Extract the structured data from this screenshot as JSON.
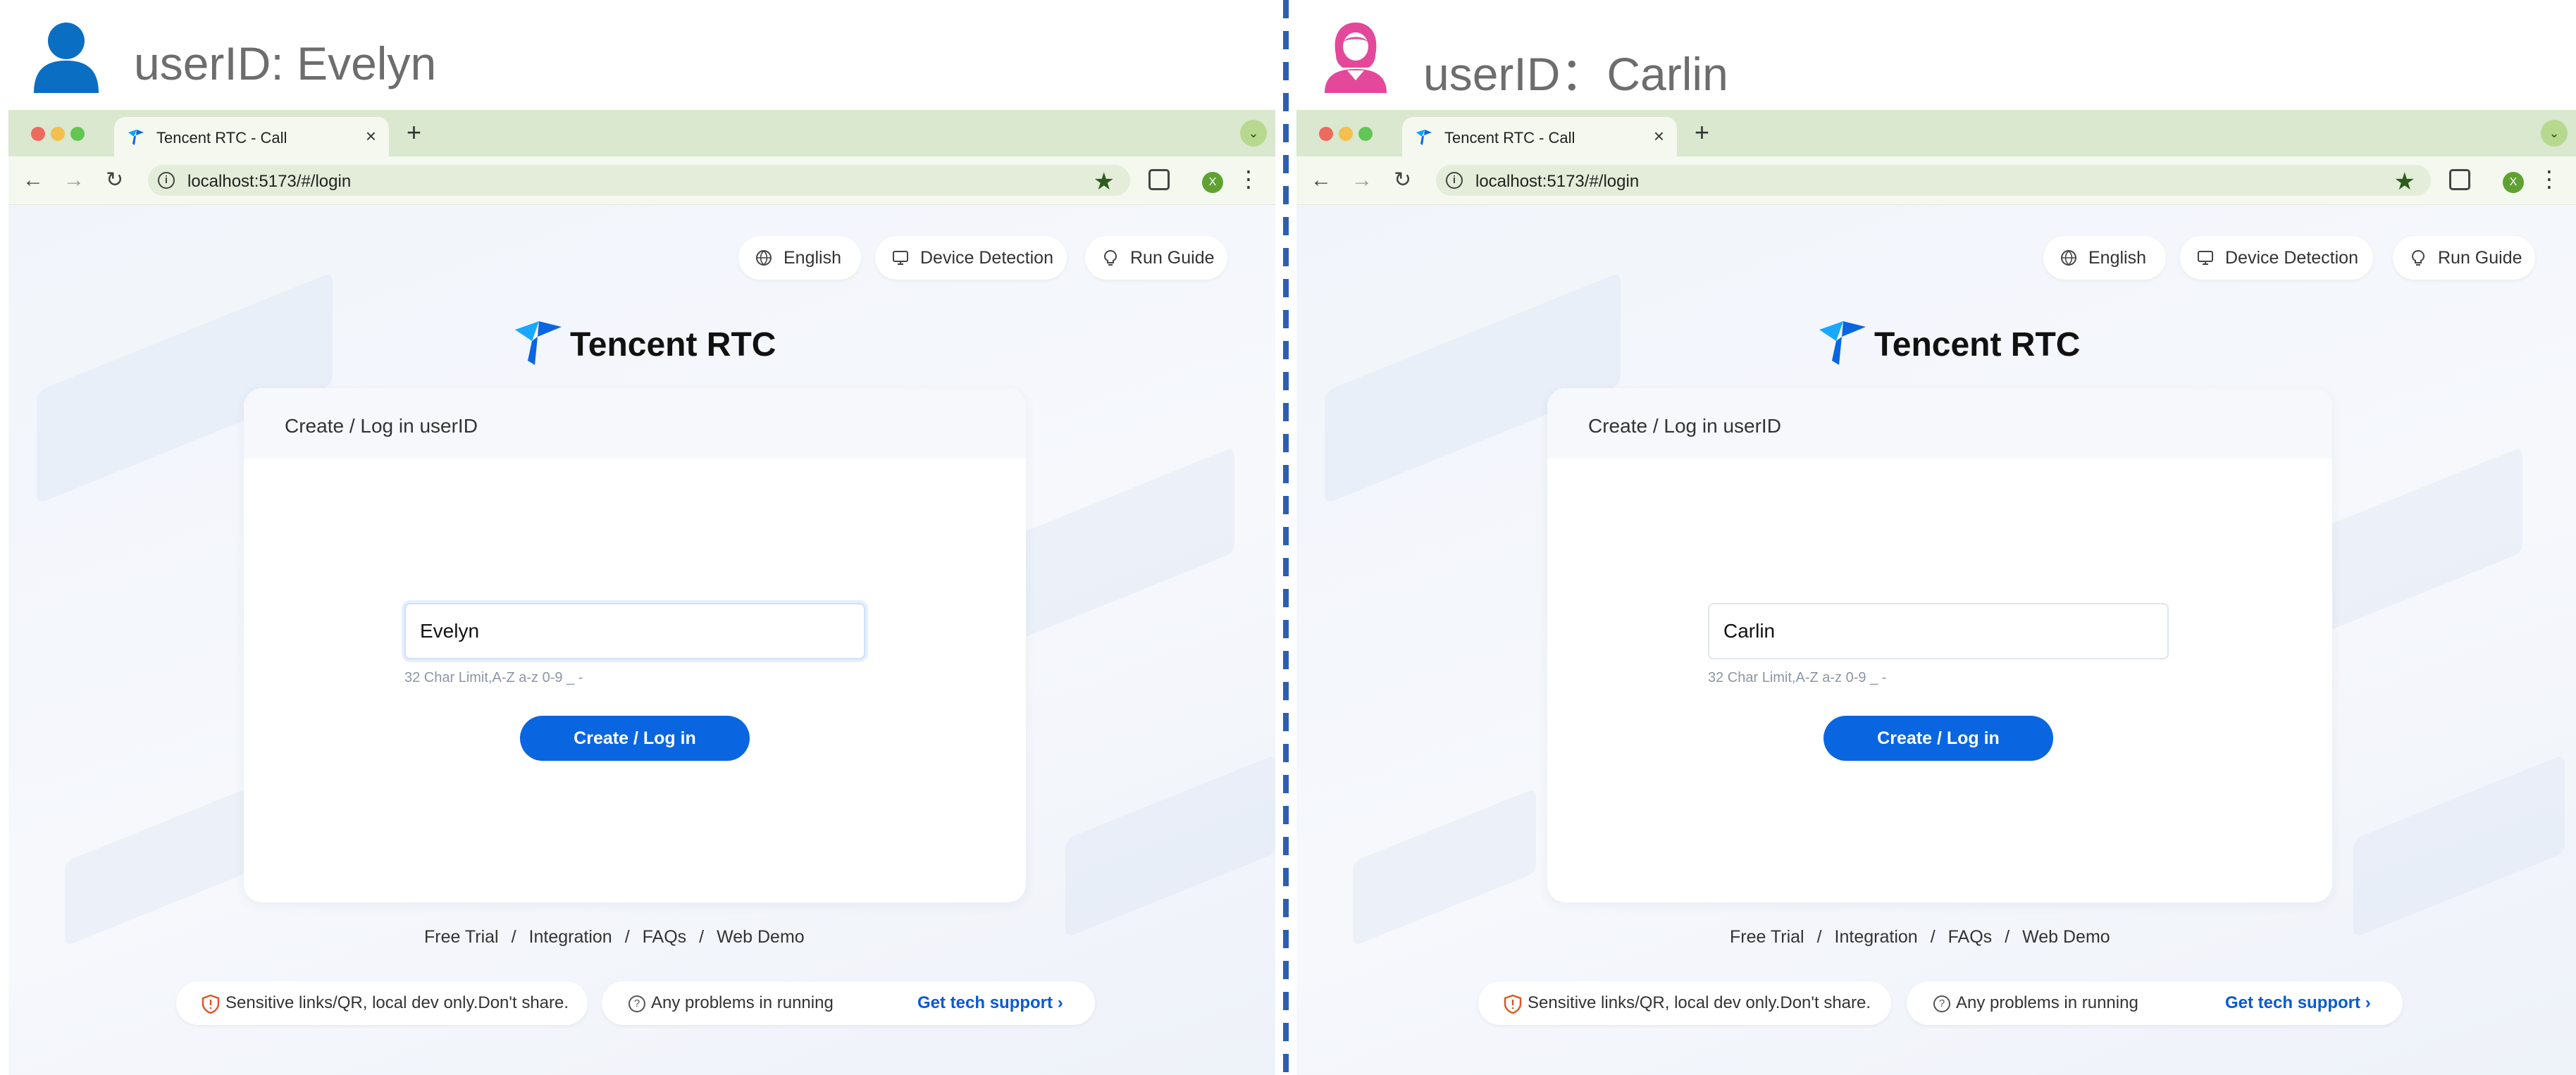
{
  "divider_color": "#2d5fb0",
  "sessions": [
    {
      "user_title": "userID: Evelyn",
      "avatar_icon": "male-user-icon",
      "avatar_color": "#0a6fc2",
      "browser": {
        "tab_title": "Tencent RTC - Call",
        "url": "localhost:5173/#/login",
        "profile_initial": "X"
      },
      "page": {
        "top_buttons": {
          "language": "English",
          "device_detection": "Device Detection",
          "run_guide": "Run Guide"
        },
        "logo_text": "Tencent RTC",
        "card_title": "Create / Log in userID",
        "input_value": "Evelyn",
        "input_focused": true,
        "hint": "32 Char Limit,A-Z a-z 0-9 _ -",
        "login_button": "Create / Log in",
        "footer_links": [
          "Free Trial",
          "Integration",
          "FAQs",
          "Web Demo"
        ],
        "footer_separator": "/",
        "notice": "Sensitive links/QR, local dev only.Don't share.",
        "help_text": "Any problems in running",
        "tech_support": "Get tech support"
      }
    },
    {
      "user_title": "userID：Carlin",
      "avatar_icon": "female-user-icon",
      "avatar_color": "#e3489a",
      "browser": {
        "tab_title": "Tencent RTC - Call",
        "url": "localhost:5173/#/login",
        "profile_initial": "X"
      },
      "page": {
        "top_buttons": {
          "language": "English",
          "device_detection": "Device Detection",
          "run_guide": "Run Guide"
        },
        "logo_text": "Tencent RTC",
        "card_title": "Create / Log in userID",
        "input_value": "Carlin",
        "input_focused": false,
        "hint": "32 Char Limit,A-Z a-z 0-9 _ -",
        "login_button": "Create / Log in",
        "footer_links": [
          "Free Trial",
          "Integration",
          "FAQs",
          "Web Demo"
        ],
        "footer_separator": "/",
        "notice": "Sensitive links/QR, local dev only.Don't share.",
        "help_text": "Any problems in running",
        "tech_support": "Get tech support"
      }
    }
  ]
}
